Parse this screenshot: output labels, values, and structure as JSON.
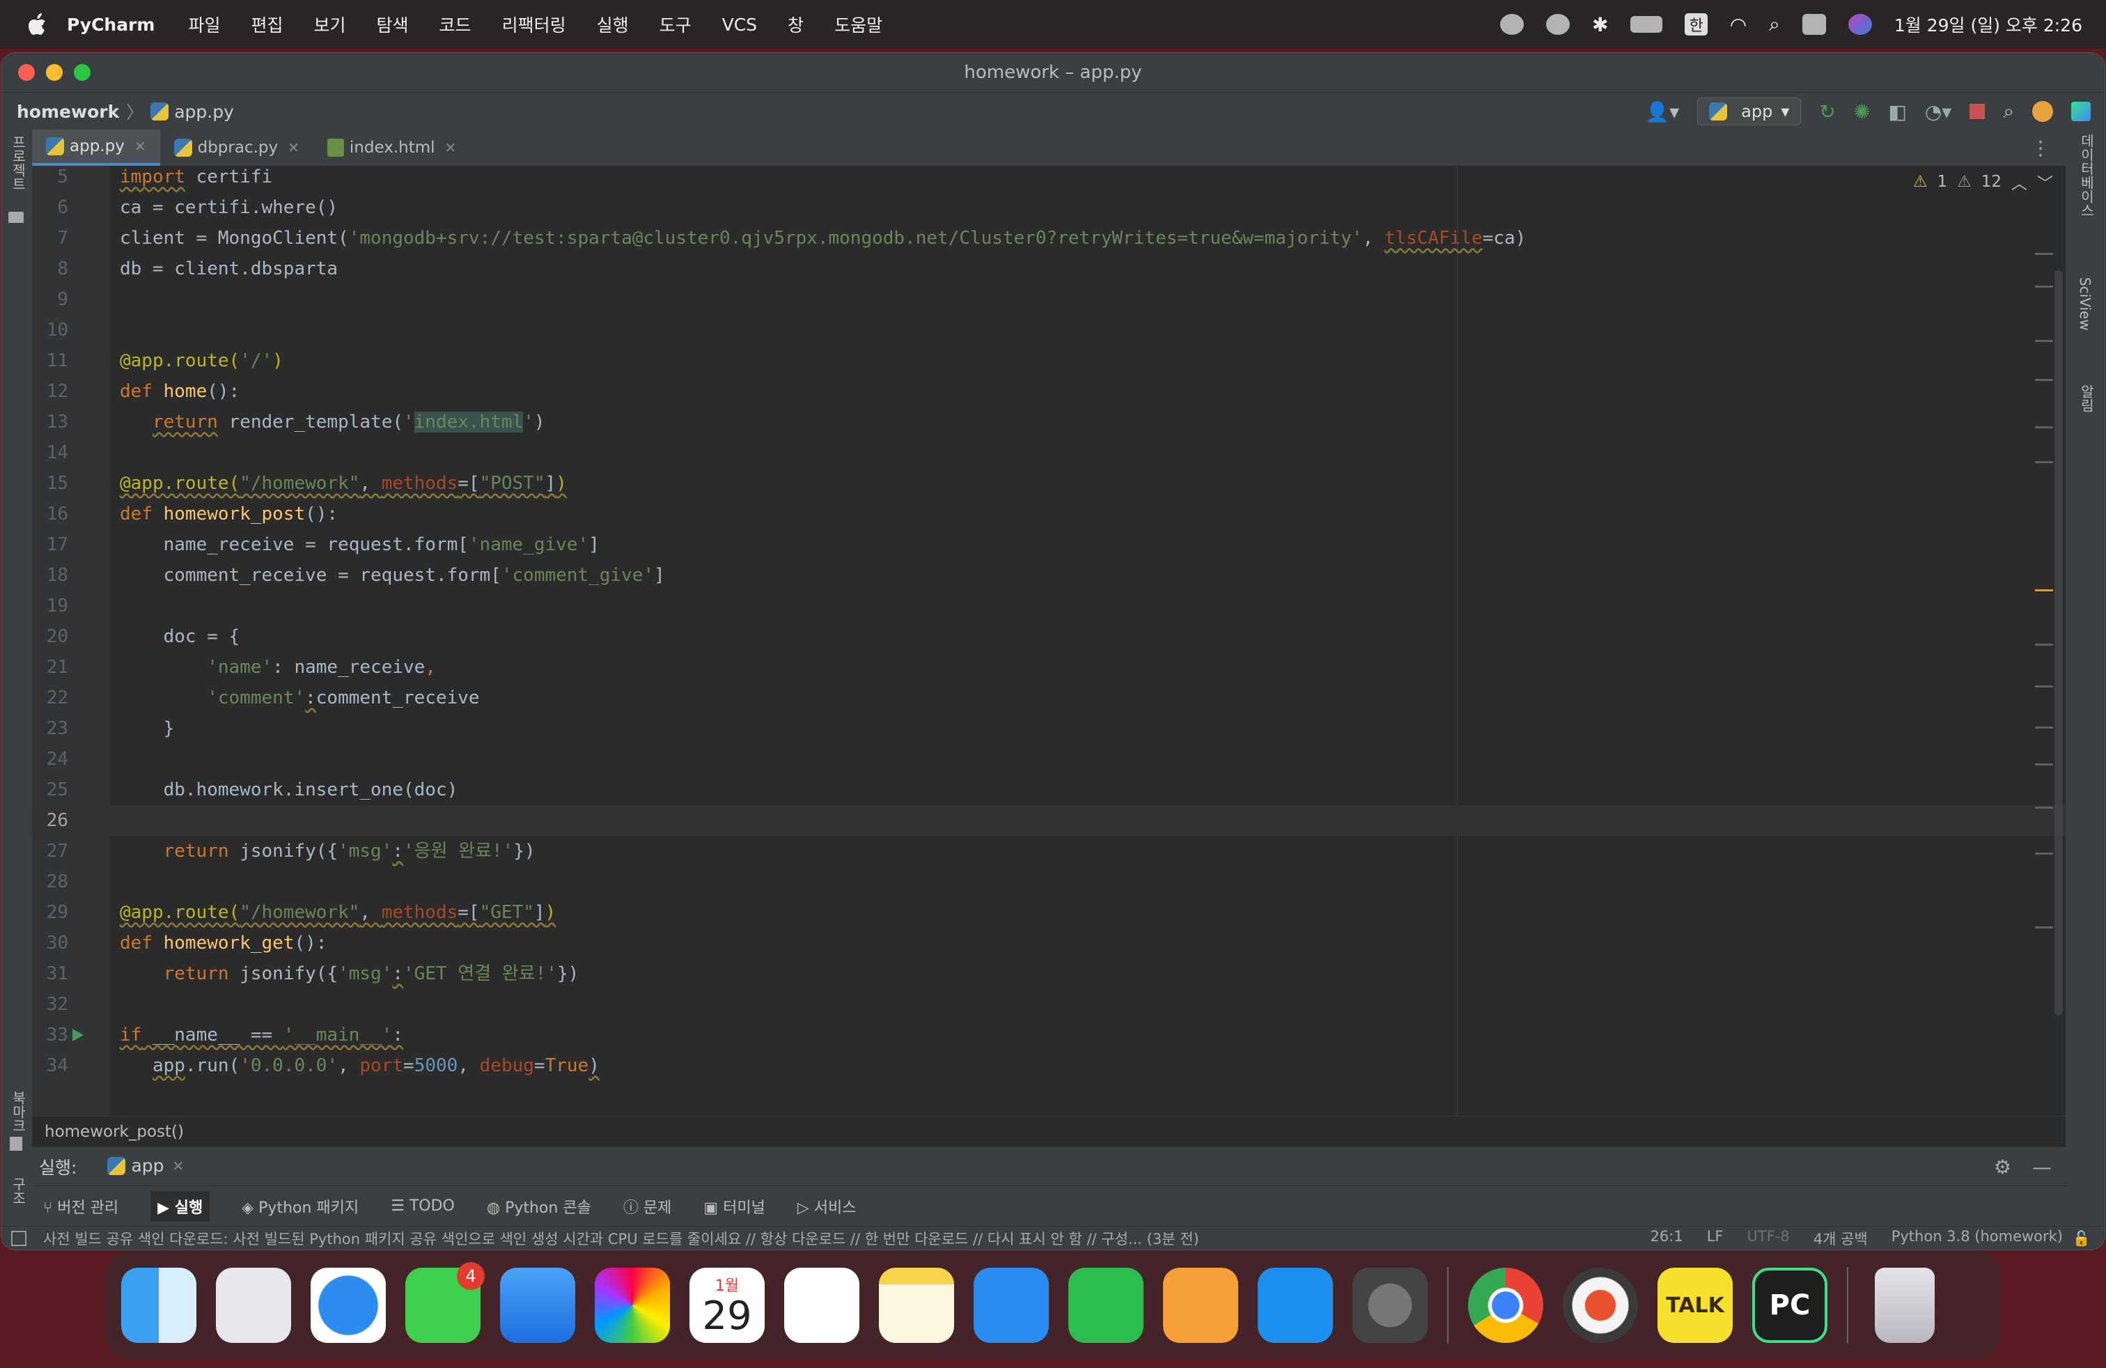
{
  "menubar": {
    "app_name": "PyCharm",
    "items": [
      "파일",
      "편집",
      "보기",
      "탐색",
      "코드",
      "리팩터링",
      "실행",
      "도구",
      "VCS",
      "창",
      "도움말"
    ],
    "ime": "한",
    "clock": "1월 29일 (일) 오후 2:26"
  },
  "window": {
    "title": "homework – app.py",
    "breadcrumb": {
      "project": "homework",
      "file": "app.py"
    },
    "run_config": "app",
    "left_strip": {
      "top": "프로젝트",
      "bottom1": "북마크",
      "bottom2": "구조"
    },
    "right_strip": {
      "db": "데이터베이스",
      "sciview": "SciView",
      "notify": "알림"
    }
  },
  "tabs": [
    {
      "label": "app.py",
      "icon": "python-file-icon",
      "active": true
    },
    {
      "label": "dbprac.py",
      "icon": "python-file-icon",
      "active": false
    },
    {
      "label": "index.html",
      "icon": "html-file-icon",
      "active": false
    }
  ],
  "inspections": {
    "warnings": "1",
    "weak_warnings": "12"
  },
  "editor": {
    "current_line": "26",
    "lines": [
      {
        "n": "5",
        "html": "<span class='kw sq'>import</span> certifi"
      },
      {
        "n": "6",
        "html": "ca = certifi.where()"
      },
      {
        "n": "7",
        "html": "client = MongoClient(<span class='str'>'mongodb+srv://test:sparta@cluster0.qjv5rpx.mongodb.net/Cluster0?retryWrites=true&amp;w=majority'</span>, <span class='param sq'>tlsCAFile</span>=ca)"
      },
      {
        "n": "8",
        "html": "db = client.dbsparta"
      },
      {
        "n": "9",
        "html": ""
      },
      {
        "n": "10",
        "html": ""
      },
      {
        "n": "11",
        "html": "<span class='dec'>@app.route(</span><span class='str'>'/'</span><span class='dec'>)</span>"
      },
      {
        "n": "12",
        "html": "<span class='kw'>def</span> <span class='fn'>home</span>():"
      },
      {
        "n": "13",
        "html": "   <span class='kw sq'>return</span> render_template(<span class='str'>'<span class=\"hl\">index.html</span>'</span>)"
      },
      {
        "n": "14",
        "html": ""
      },
      {
        "n": "15",
        "html": "<span class='sq'><span class='dec'>@app.route(</span><span class='str'>\"/homework\"</span>, <span class='param'>methods</span>=[<span class='str'>\"POST\"</span>]<span class='dec'>)</span></span>"
      },
      {
        "n": "16",
        "html": "<span class='kw'>def</span> <span class='fn'>homework_post</span>():"
      },
      {
        "n": "17",
        "html": "    name_receive = request.form[<span class='str'>'name_give'</span>]"
      },
      {
        "n": "18",
        "html": "    comment_receive = request.form[<span class='str'>'comment_give'</span>]"
      },
      {
        "n": "19",
        "html": ""
      },
      {
        "n": "20",
        "html": "    doc = {"
      },
      {
        "n": "21",
        "html": "        <span class='str'>'name'</span>: name_receive<span class='kw'>,</span>"
      },
      {
        "n": "22",
        "html": "        <span class='str'>'comment'</span><span class='sq'>:</span>comment_receive"
      },
      {
        "n": "23",
        "html": "    }"
      },
      {
        "n": "24",
        "html": ""
      },
      {
        "n": "25",
        "html": "    db.homework.insert_one(doc)"
      },
      {
        "n": "26",
        "html": ""
      },
      {
        "n": "27",
        "html": "    <span class='kw'>return</span> jsonify({<span class='str'>'msg'</span><span class='sq'>:</span><span class='str'>'응원 완료!'</span>})"
      },
      {
        "n": "28",
        "html": ""
      },
      {
        "n": "29",
        "html": "<span class='sq'><span class='dec'>@app.route(</span><span class='str'>\"/homework\"</span>, <span class='param'>methods</span>=[<span class='str'>\"GET\"</span>]<span class='dec'>)</span></span>"
      },
      {
        "n": "30",
        "html": "<span class='kw'>def</span> <span class='fn'>homework_get</span>():"
      },
      {
        "n": "31",
        "html": "    <span class='kw'>return</span> jsonify({<span class='str'>'msg'</span><span class='sq'>:</span><span class='str'>'GET 연결 완료!'</span>})"
      },
      {
        "n": "32",
        "html": ""
      },
      {
        "n": "33",
        "html": "<span class='kw sq'>if</span><span class='sq'> __name__ == <span class='str'>'__main__'</span>:</span>",
        "run": true
      },
      {
        "n": "34",
        "html": "   <span class='sq'>app</span>.run(<span class='str'>'0.0.0.0'</span>, <span class='param'>port</span>=<span class='num'>5000</span>, <span class='param'>debug</span>=<span class='kw'>True</span><span class='sq'>)</span>"
      }
    ]
  },
  "structure_crumb": "homework_post()",
  "run_panel": {
    "label": "실행:",
    "tab": "app"
  },
  "tool_windows": [
    "버전 관리",
    "실행",
    "Python 패키지",
    "TODO",
    "Python 콘솔",
    "문제",
    "터미널",
    "서비스"
  ],
  "status": {
    "message": "사전 빌드 공유 색인 다운로드: 사전 빌드된 Python 패키지 공유 색인으로 색인 생성 시간과 CPU 로드를 줄이세요 // 항상 다운로드 // 한 번만 다운로드 // 다시 표시 안 함 // 구성... (3분 전)",
    "position": "26:1",
    "line_sep": "LF",
    "encoding": "UTF-8",
    "indent": "4개 공백",
    "interpreter": "Python 3.8 (homework)"
  },
  "dock": {
    "messages_badge": "4",
    "calendar_month": "1월",
    "calendar_day": "29",
    "kakao_label": "TALK",
    "pycharm_label": "PC"
  }
}
